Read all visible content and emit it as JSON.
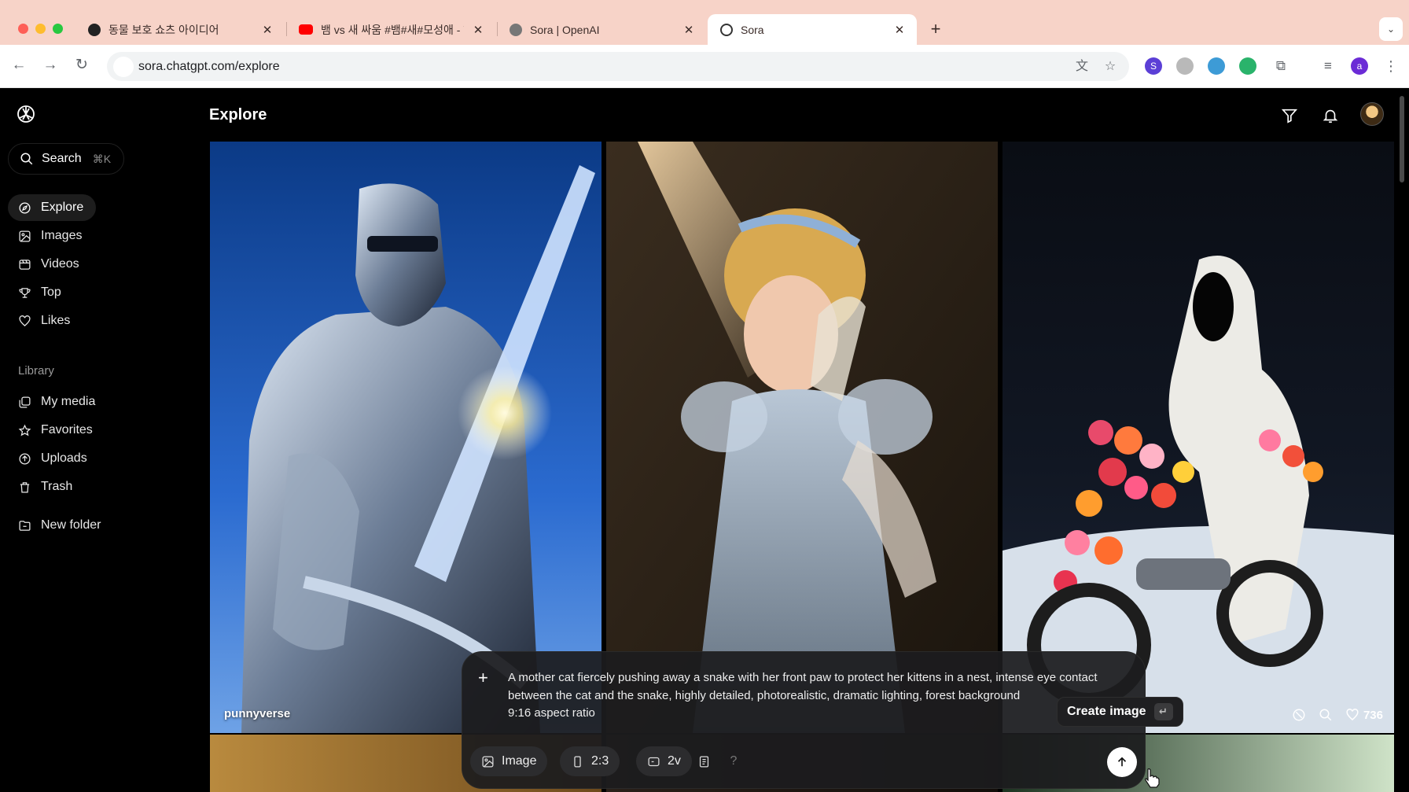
{
  "browser": {
    "tabs": [
      {
        "title": "동물 보호 쇼츠 아이디어",
        "favicon": "openai-icon",
        "active": false
      },
      {
        "title": "뱀 vs 새 싸움 #뱀#새#모성애 - Yo",
        "favicon": "youtube-icon",
        "active": false
      },
      {
        "title": "Sora | OpenAI",
        "favicon": "openai-icon",
        "active": false
      },
      {
        "title": "Sora",
        "favicon": "sora-icon",
        "active": true
      }
    ],
    "url": "sora.chatgpt.com/explore",
    "profile_initial": "a"
  },
  "sidebar": {
    "search_label": "Search",
    "search_shortcut": "⌘K",
    "items": [
      {
        "label": "Explore",
        "icon": "compass-icon",
        "active": true
      },
      {
        "label": "Images",
        "icon": "image-icon"
      },
      {
        "label": "Videos",
        "icon": "video-icon"
      },
      {
        "label": "Top",
        "icon": "trophy-icon"
      },
      {
        "label": "Likes",
        "icon": "heart-icon"
      }
    ],
    "library_label": "Library",
    "library_items": [
      {
        "label": "My media",
        "icon": "media-icon"
      },
      {
        "label": "Favorites",
        "icon": "star-icon"
      },
      {
        "label": "Uploads",
        "icon": "upload-icon"
      },
      {
        "label": "Trash",
        "icon": "trash-icon"
      }
    ],
    "new_folder_label": "New folder"
  },
  "header": {
    "title": "Explore",
    "icons": [
      "filter-icon",
      "bell-icon",
      "avatar"
    ]
  },
  "grid": {
    "cards": [
      {
        "author": "punnyverse",
        "subject": "knight in chrome armor with sword"
      },
      {
        "author": "",
        "subject": "woman in silver dress on vintage phone"
      },
      {
        "author": "",
        "subject": "hooded figure on flower motorcycle in snow",
        "likes": "736"
      }
    ]
  },
  "composer": {
    "prompt": "A mother cat fiercely pushing away a snake with her front paw to protect her kittens in a nest, intense eye contact between the cat and the snake, highly detailed, photorealistic, dramatic lighting, forest background",
    "prompt_line2": "9:16 aspect ratio",
    "chips": {
      "type": "Image",
      "aspect": "2:3",
      "variations": "2v"
    },
    "help": "?",
    "tooltip": "Create image",
    "tooltip_key": "↵"
  },
  "colors": {
    "tabbar": "#f7d3c8",
    "bg": "#000000",
    "accent": "#ffffff"
  }
}
